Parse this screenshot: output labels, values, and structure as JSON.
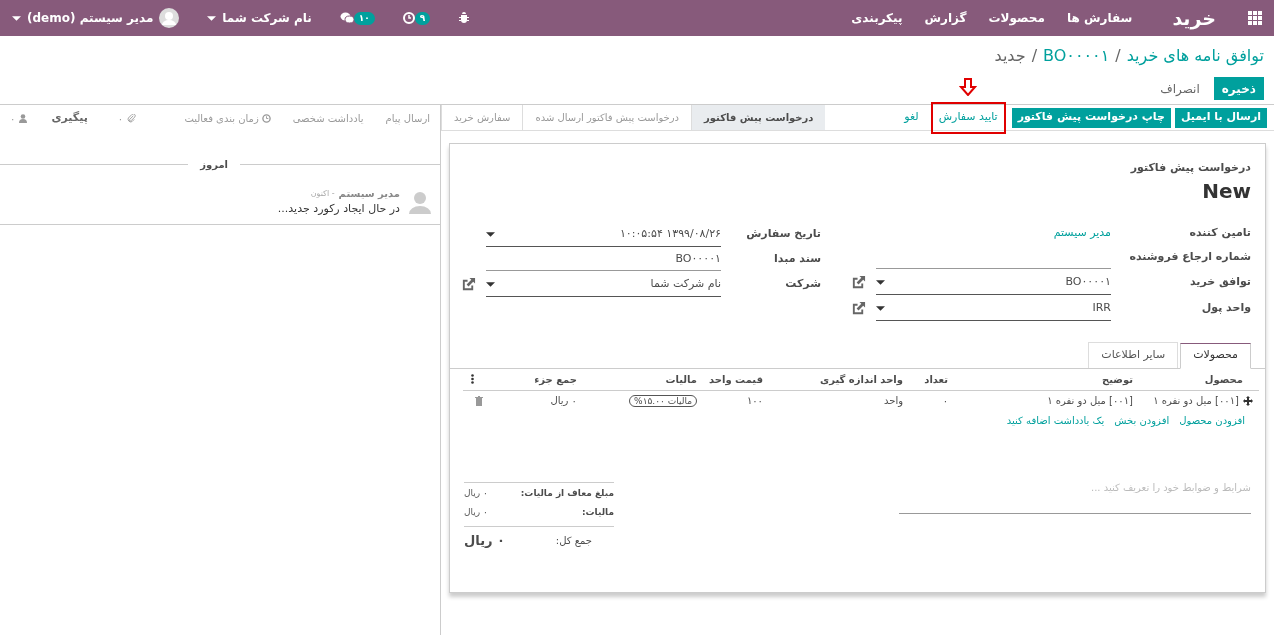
{
  "navbar": {
    "brand": "خرید",
    "menu": [
      "سفارش ها",
      "محصولات",
      "گزارش",
      "پیکربندی"
    ],
    "activity_count": "۹",
    "message_count": "۱۰",
    "company": "نام شرکت شما",
    "user": "مدیر سیستم (demo)"
  },
  "breadcrumb": {
    "separator": "/",
    "items": [
      {
        "label": "توافق نامه های خرید",
        "link": true
      },
      {
        "label": "BO۰۰۰۰۱",
        "link": true
      },
      {
        "label": "جدید",
        "link": false
      }
    ]
  },
  "actions": [
    {
      "label": "ذخیره",
      "kind": "primary"
    },
    {
      "label": "انصراف",
      "kind": "link"
    }
  ],
  "header_buttons": [
    {
      "label": "ارسال با ایمیل",
      "kind": "primary",
      "highlighted": false
    },
    {
      "label": "چاپ درخواست پیش فاکتور",
      "kind": "primary",
      "highlighted": false
    },
    {
      "label": "تایید سفارش",
      "kind": "secondary",
      "highlighted": true
    },
    {
      "label": "لغو",
      "kind": "secondary",
      "highlighted": false
    }
  ],
  "stages": [
    {
      "label": "درخواست پیش فاکتور",
      "selected": true
    },
    {
      "label": "درخواست پیش فاکتور ارسال شده",
      "selected": false
    },
    {
      "label": "سفارش خرید",
      "selected": false
    }
  ],
  "chatter": {
    "send_message": "ارسال پیام",
    "log_note": "یادداشت شخصی",
    "schedule": "زمان بندی فعالیت",
    "attachments": "۰",
    "follow": "پیگیری",
    "followers": "۰",
    "date_separator": "امروز",
    "messages": [
      {
        "author": "مدیر سیستم",
        "time": "- اکنون",
        "body": "در حال ایجاد رکورد جدید..."
      }
    ]
  },
  "form": {
    "subtitle": "درخواست پیش فاکتور",
    "title": "New",
    "fields_right": [
      {
        "label": "تامین کننده",
        "kind": "link",
        "value": "مدیر سیستم"
      },
      {
        "label": "شماره ارجاع فروشنده",
        "kind": "input"
      },
      {
        "label": "توافق خرید",
        "kind": "select",
        "value": "BO۰۰۰۰۱",
        "external": true
      },
      {
        "label": "واحد پول",
        "kind": "select",
        "value": "IRR",
        "external": true
      }
    ],
    "fields_left": [
      {
        "label": "تاریخ سفارش",
        "kind": "select",
        "value": "۱۳۹۹/۰۸/۲۶ ۱۰:۰۵:۵۴",
        "external": false
      },
      {
        "label": "سند مبدا",
        "kind": "input",
        "value": "BO۰۰۰۰۱"
      },
      {
        "label": "شرکت",
        "kind": "select",
        "value": "نام شرکت شما",
        "external": true
      }
    ],
    "tabs": [
      {
        "label": "محصولات",
        "selected": true
      },
      {
        "label": "سایر اطلاعات",
        "selected": false
      }
    ],
    "table": {
      "columns": [
        "محصول",
        "توضیح",
        "تعداد",
        "واحد اندازه گیری",
        "قیمت واحد",
        "مالیات",
        "جمع جزء"
      ],
      "rows": [
        {
          "cells": [
            "[۰۰۱] میل دو نفره ۱",
            "[۰۰۱] میل دو نفره ۱",
            "۰",
            "واحد",
            "۱۰۰",
            "مالیات ۱۵.۰۰%",
            "۰ ریال"
          ]
        }
      ],
      "add_links": [
        "افزودن محصول",
        "افزودن بخش",
        "یک یادداشت اضافه کنید"
      ]
    },
    "notes_placeholder": "شرایط و ضوابط خود را تعریف کنید ...",
    "totals": [
      {
        "label": "مبلغ معاف از مالیات:",
        "value": "۰ ریال"
      },
      {
        "label": "مالیات:",
        "value": "۰ ریال"
      }
    ],
    "total": {
      "label": "جمع کل:",
      "value": "۰ ریال"
    }
  }
}
